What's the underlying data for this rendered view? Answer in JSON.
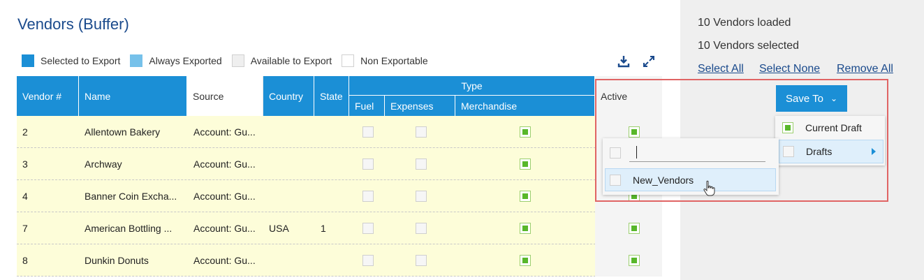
{
  "title": "Vendors (Buffer)",
  "legend": {
    "selected": "Selected to Export",
    "always": "Always Exported",
    "available": "Available to Export",
    "non": "Non Exportable"
  },
  "toolbar_icons": [
    "download-icon",
    "expand-icon"
  ],
  "columns": {
    "vendor": "Vendor #",
    "name": "Name",
    "source": "Source",
    "country": "Country",
    "state": "State",
    "type": "Type",
    "fuel": "Fuel",
    "expenses": "Expenses",
    "merchandise": "Merchandise",
    "active": "Active"
  },
  "rows": [
    {
      "vendor": "2",
      "name": "Allentown Bakery",
      "source": "Account: Gu...",
      "country": "",
      "state": "",
      "fuel": false,
      "expenses": false,
      "merchandise": true,
      "active": true
    },
    {
      "vendor": "3",
      "name": "Archway",
      "source": "Account: Gu...",
      "country": "",
      "state": "",
      "fuel": false,
      "expenses": false,
      "merchandise": true,
      "active": true
    },
    {
      "vendor": "4",
      "name": "Banner Coin Excha...",
      "source": "Account: Gu...",
      "country": "",
      "state": "",
      "fuel": false,
      "expenses": false,
      "merchandise": true,
      "active": true
    },
    {
      "vendor": "7",
      "name": "American Bottling ...",
      "source": "Account: Gu...",
      "country": "USA",
      "state": "1",
      "fuel": false,
      "expenses": false,
      "merchandise": true,
      "active": true
    },
    {
      "vendor": "8",
      "name": "Dunkin Donuts",
      "source": "Account: Gu...",
      "country": "",
      "state": "",
      "fuel": false,
      "expenses": false,
      "merchandise": true,
      "active": true
    }
  ],
  "status": {
    "loaded": "10 Vendors loaded",
    "selected": "10 Vendors selected"
  },
  "links": {
    "select_all": "Select All",
    "select_none": "Select None",
    "remove_all": "Remove All"
  },
  "save_to": {
    "label": "Save To",
    "menu": {
      "current_draft": "Current Draft",
      "current_draft_checked": true,
      "drafts": "Drafts",
      "drafts_checked": false
    },
    "submenu": {
      "input_value": "",
      "new_item": "New_Vendors"
    }
  },
  "colors": {
    "header_blue": "#1b8fd6",
    "title_blue": "#1a4a8c",
    "row_yellow": "#fdfdd9",
    "check_green": "#58b72a",
    "highlight_red": "#e06464"
  }
}
